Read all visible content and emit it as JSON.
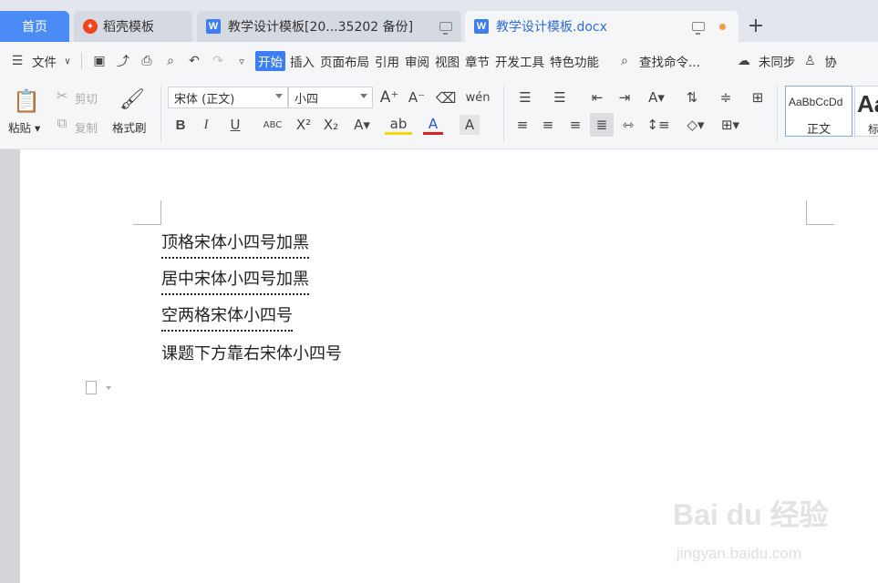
{
  "tabs": {
    "home": "首页",
    "dao": "稻壳模板",
    "doc1": "教学设计模板[20...35202 备份]",
    "doc2": "教学设计模板.docx",
    "new": "+"
  },
  "menu": {
    "file": "文件",
    "items": [
      "开始",
      "插入",
      "页面布局",
      "引用",
      "审阅",
      "视图",
      "章节",
      "开发工具",
      "特色功能"
    ],
    "search": "查找命令...",
    "sync": "未同步",
    "collab": "协"
  },
  "ribbon": {
    "paste": "粘贴",
    "cut": "剪切",
    "copy": "复制",
    "format_painter": "格式刷",
    "font_name": "宋体 (正文)",
    "font_size": "小四",
    "style_sample": "AaBbCcDd",
    "style_normal": "正文",
    "style_sample2": "Aa",
    "style_title": "标"
  },
  "document": {
    "lines": [
      "顶格宋体小四号加黑",
      "居中宋体小四号加黑",
      "空两格宋体小四号",
      "课题下方靠右宋体小四号"
    ]
  },
  "watermark": {
    "brand": "Bai du 经验",
    "url": "jingyan.baidu.com"
  },
  "colors": {
    "accent": "#3d7ef2",
    "home_tab": "#4a8bf5",
    "tab_active_text": "#2f6cd8",
    "unsaved_dot": "#f39a4a"
  }
}
